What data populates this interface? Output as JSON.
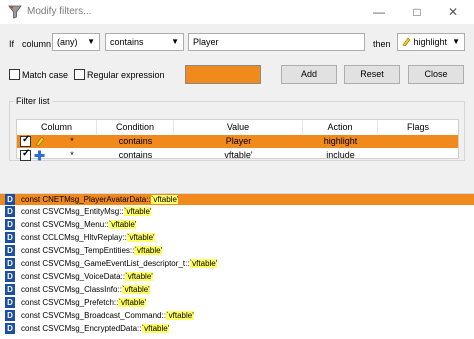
{
  "window": {
    "title": "Modify filters..."
  },
  "filter_row": {
    "if_label": "If",
    "column_value": "column",
    "column_field": "(any)",
    "condition_field": "contains",
    "search_value": "Player",
    "then_label": "then",
    "action_field": "highlight"
  },
  "options": {
    "match_case_label": "Match case",
    "regex_label": "Regular expression",
    "color_swatch": "#f08a1c"
  },
  "buttons": {
    "add": "Add",
    "reset": "Reset",
    "close": "Close"
  },
  "filter_list": {
    "title": "Filter list",
    "columns": [
      "Column",
      "Condition",
      "Value",
      "Action",
      "Flags"
    ],
    "rows": [
      {
        "column": "*",
        "condition": "contains",
        "value": "Player",
        "action": "highlight",
        "flags": "",
        "selected": true
      },
      {
        "column": "*",
        "condition": "contains",
        "value": "vftable'",
        "action": "include",
        "flags": "",
        "selected": false
      }
    ]
  },
  "results": [
    {
      "badge": "D",
      "prefix": "const CNETMsg_PlayerAvatarData::",
      "match": "`vftable'",
      "highlighted_row": true
    },
    {
      "badge": "D",
      "prefix": "const CSVCMsg_EntityMsg::",
      "match": "`vftable'"
    },
    {
      "badge": "D",
      "prefix": "const CSVCMsg_Menu::",
      "match": "`vftable'"
    },
    {
      "badge": "D",
      "prefix": "const CCLCMsg_HltvReplay::",
      "match": "`vftable'"
    },
    {
      "badge": "D",
      "prefix": "const CSVCMsg_TempEntities::",
      "match": "`vftable'"
    },
    {
      "badge": "D",
      "prefix": "const CSVCMsg_GameEventList_descriptor_t::",
      "match": "`vftable'"
    },
    {
      "badge": "D",
      "prefix": "const CSVCMsg_VoiceData::",
      "match": "`vftable'"
    },
    {
      "badge": "D",
      "prefix": "const CSVCMsg_ClassInfo::",
      "match": "`vftable'"
    },
    {
      "badge": "D",
      "prefix": "const CSVCMsg_Prefetch::",
      "match": "`vftable'"
    },
    {
      "badge": "D",
      "prefix": "const CSVCMsg_Broadcast_Command::",
      "match": "`vftable'"
    },
    {
      "badge": "D",
      "prefix": "const CSVCMsg_EncryptedData::",
      "match": "`vftable'"
    }
  ],
  "colors": {
    "selection_orange": "#f08a1c",
    "match_yellow": "#ffff66",
    "badge_blue": "#1c4fa3"
  },
  "icons": {
    "app": "filter-funnel-icon",
    "highlight_action": "highlighter-pen-icon",
    "include_action": "plus-cross-icon"
  }
}
